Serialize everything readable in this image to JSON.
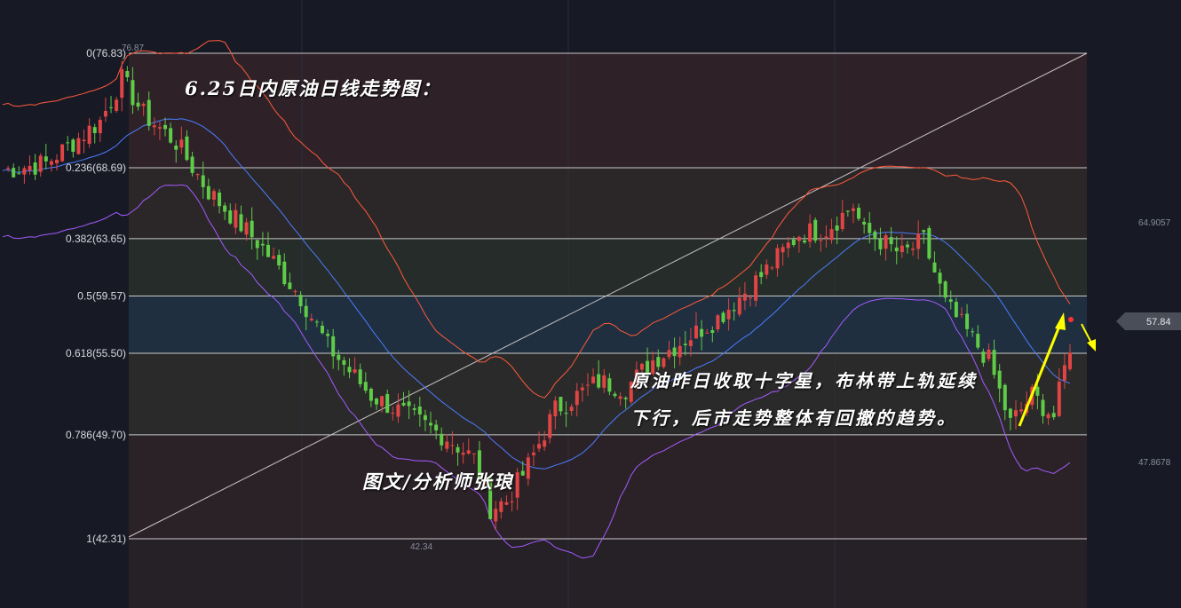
{
  "chart_data": {
    "type": "candlestick",
    "title": "6.25日内原油日线走势图：",
    "fib_levels": [
      {
        "ratio": "0",
        "price": 76.83,
        "label": "0(76.83)"
      },
      {
        "ratio": "0.236",
        "price": 68.69,
        "label": "0.236(68.69)"
      },
      {
        "ratio": "0.382",
        "price": 63.65,
        "label": "0.382(63.65)"
      },
      {
        "ratio": "0.5",
        "price": 59.57,
        "label": "0.5(59.57)"
      },
      {
        "ratio": "0.618",
        "price": 55.5,
        "label": "0.618(55.50)"
      },
      {
        "ratio": "0.786",
        "price": 49.7,
        "label": "0.786(49.70)"
      },
      {
        "ratio": "1",
        "price": 42.31,
        "label": "1(42.31)"
      }
    ],
    "high_marker": "76.87",
    "low_marker": "42.34",
    "right_axis": {
      "upper": "64.9057",
      "lower": "47.8678"
    },
    "last_price": "57.84",
    "ylim": [
      35.0,
      80.0
    ],
    "candle_count": 160,
    "bollinger": {
      "upper": "#ff5a3c",
      "middle": "#4a7dff",
      "lower": "#a45bff"
    },
    "colors": {
      "up": "#e04444",
      "down": "#5fcc48",
      "trendline": "#c9c4c4",
      "arrow": "#ffff00"
    }
  },
  "annotations": {
    "author": "图文/分析师张琅",
    "analysis": "原油昨日收取十字星，布林带上轨延续下行，后市走势整体有回撤的趋势。"
  }
}
